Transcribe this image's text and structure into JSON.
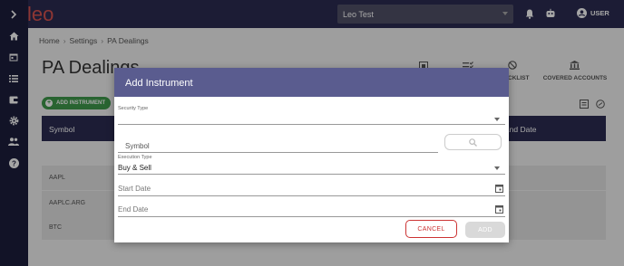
{
  "app": {
    "logo_text": "leo"
  },
  "topbar": {
    "company": "Leo Test",
    "user_label": "USER"
  },
  "breadcrumb": {
    "items": [
      "Home",
      "Settings",
      "PA Dealings"
    ]
  },
  "page": {
    "title": "PA Dealings",
    "add_button": "ADD INSTRUMENT"
  },
  "toolbar": {
    "visible_label_fragment": "CKLIST",
    "covered_accounts": "COVERED ACCOUNTS"
  },
  "table": {
    "headers": [
      "Symbol",
      "End Date"
    ],
    "rows": [
      "AAPL",
      "AAPLC.ARG",
      "BTC"
    ]
  },
  "dialog": {
    "title": "Add Instrument",
    "security_type_label": "Security Type",
    "security_type_value": "",
    "symbol_placeholder": "Symbol",
    "execution_type_label": "Execution Type",
    "execution_type_value": "Buy & Sell",
    "start_date_placeholder": "Start Date",
    "end_date_placeholder": "End Date",
    "cancel_label": "CANCEL",
    "add_label": "ADD"
  },
  "colors": {
    "topbar": "#2b2c52",
    "sidebar": "#1d1e3c",
    "dialog_header": "#5a5c8f",
    "accent_green": "#3f9a4c",
    "cancel_red": "#cc3333",
    "logo_red": "#d9534f"
  }
}
